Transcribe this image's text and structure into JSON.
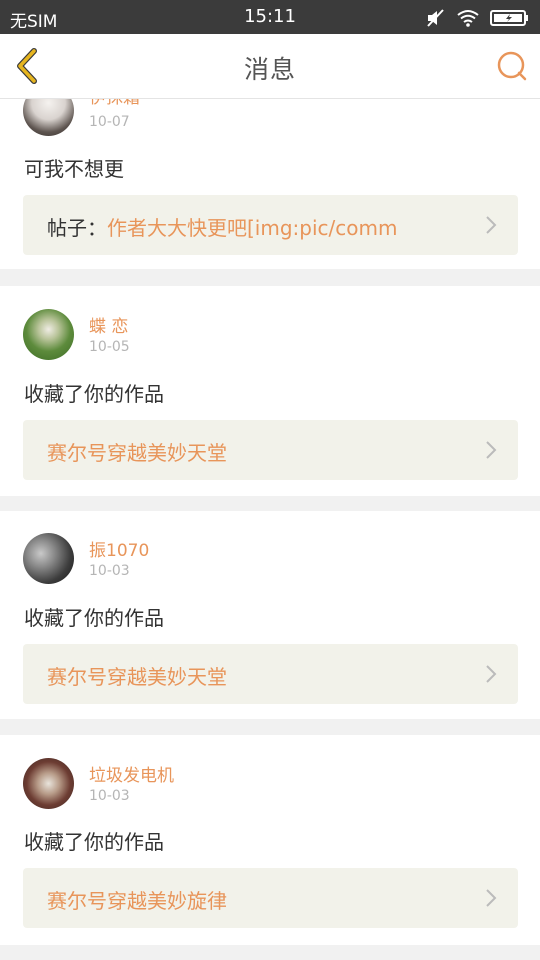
{
  "status_bar": {
    "carrier": "无SIM",
    "time": "15:11"
  },
  "header": {
    "title": "消息",
    "back_icon": "chevron-left-icon",
    "search_icon": "search-icon"
  },
  "colors": {
    "accent": "#e8955a",
    "back_arrow": "#e6b51f",
    "card_bg": "#f2f2ea"
  },
  "messages": [
    {
      "user": "伊抹霜",
      "date": "10-07",
      "text": "可我不想更",
      "link_prefix": "帖子：",
      "link": "作者大大快更吧[img:pic/comm"
    },
    {
      "user": "蝶 恋",
      "date": "10-05",
      "text": "收藏了你的作品",
      "link_prefix": "",
      "link": "赛尔号穿越美妙天堂"
    },
    {
      "user": "振1070",
      "date": "10-03",
      "text": "收藏了你的作品",
      "link_prefix": "",
      "link": "赛尔号穿越美妙天堂"
    },
    {
      "user": "垃圾发电机",
      "date": "10-03",
      "text": "收藏了你的作品",
      "link_prefix": "",
      "link": "赛尔号穿越美妙旋律"
    }
  ]
}
